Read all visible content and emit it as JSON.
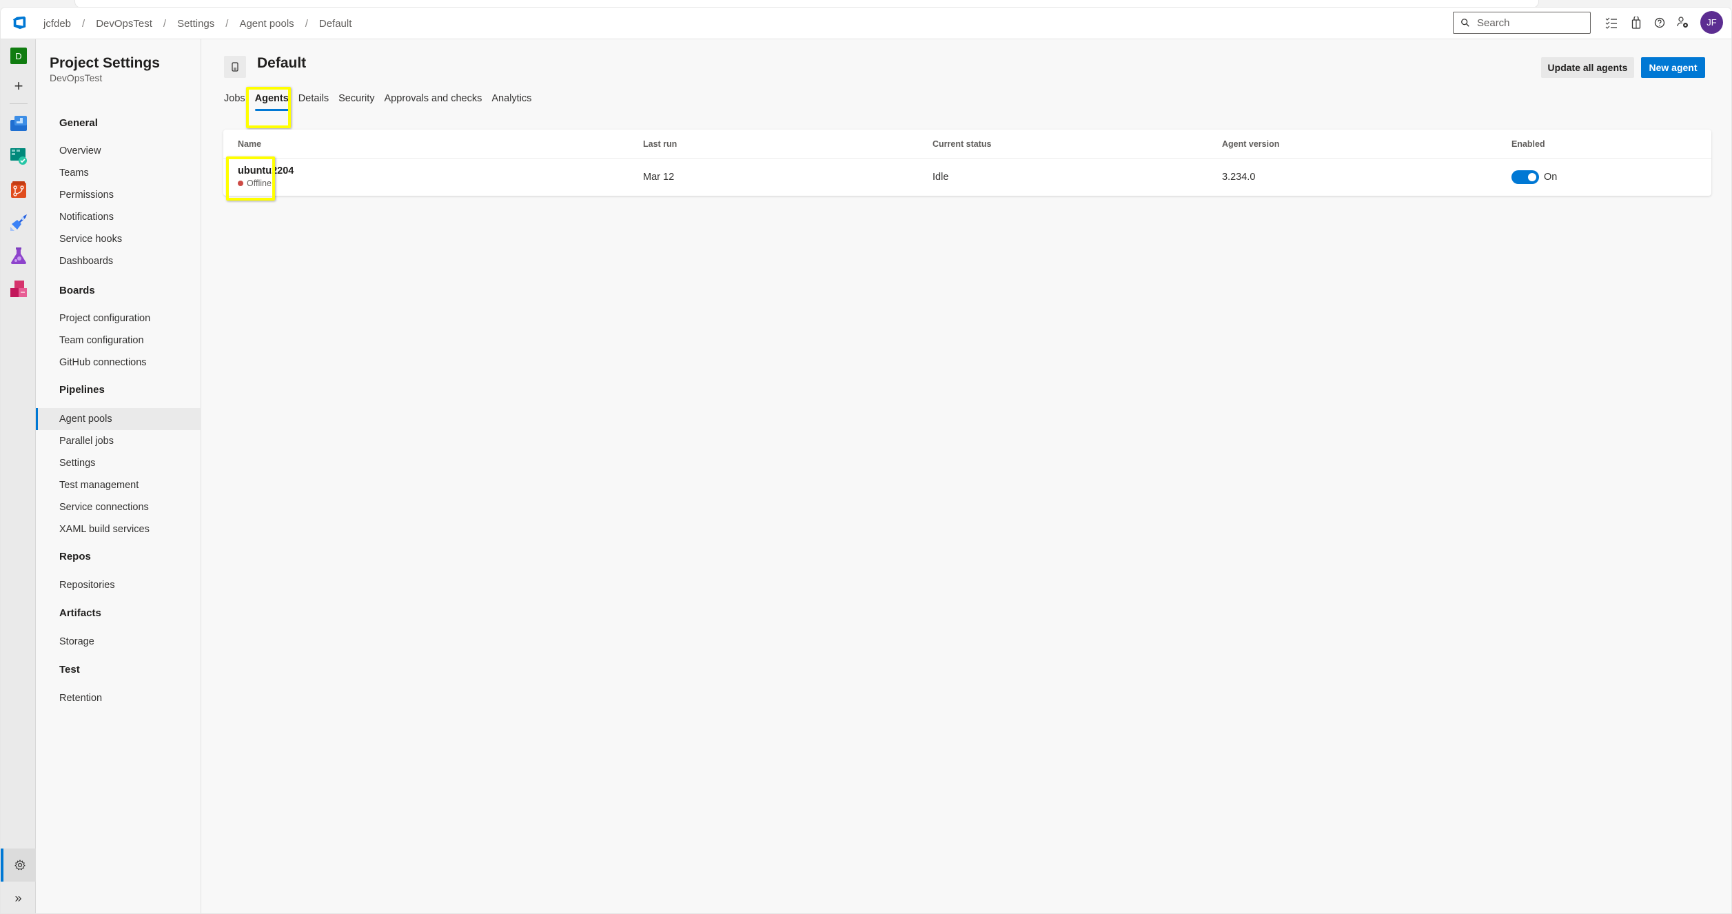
{
  "header": {
    "logo_icon": "azure-devops-logo",
    "breadcrumb": [
      "jcfdeb",
      "DevOpsTest",
      "Settings",
      "Agent pools",
      "Default"
    ],
    "search_placeholder": "Search",
    "icons": [
      "work-items-checklist-icon",
      "marketplace-bag-icon",
      "help-icon",
      "user-settings-icon"
    ],
    "avatar_initials": "JF",
    "avatar_color": "#5c2d91"
  },
  "rail": {
    "project_initial": "D",
    "project_color": "#107c10",
    "add_label": "+",
    "services": [
      "overview",
      "boards",
      "repos",
      "pipelines",
      "test-plans",
      "artifacts"
    ],
    "settings_icon": "gear-icon",
    "expand_label": "»"
  },
  "sidebar": {
    "title": "Project Settings",
    "subtitle": "DevOpsTest",
    "sections": [
      {
        "heading": "General",
        "items": [
          "Overview",
          "Teams",
          "Permissions",
          "Notifications",
          "Service hooks",
          "Dashboards"
        ]
      },
      {
        "heading": "Boards",
        "items": [
          "Project configuration",
          "Team configuration",
          "GitHub connections"
        ]
      },
      {
        "heading": "Pipelines",
        "items": [
          "Agent pools",
          "Parallel jobs",
          "Settings",
          "Test management",
          "Service connections",
          "XAML build services"
        ]
      },
      {
        "heading": "Repos",
        "items": [
          "Repositories"
        ]
      },
      {
        "heading": "Artifacts",
        "items": [
          "Storage"
        ]
      },
      {
        "heading": "Test",
        "items": [
          "Retention"
        ]
      }
    ],
    "active_item": "Agent pools"
  },
  "main": {
    "title": "Default",
    "buttons": {
      "update_all": "Update all agents",
      "new_agent": "New agent"
    },
    "tabs": [
      "Jobs",
      "Agents",
      "Details",
      "Security",
      "Approvals and checks",
      "Analytics"
    ],
    "active_tab": "Agents",
    "table": {
      "columns": [
        "Name",
        "Last run",
        "Current status",
        "Agent version",
        "Enabled"
      ],
      "rows": [
        {
          "name": "ubuntu2204",
          "status": "Offline",
          "status_color": "#cd4a45",
          "last_run": "Mar 12",
          "current_status": "Idle",
          "agent_version": "3.234.0",
          "enabled": true,
          "enabled_label": "On"
        }
      ]
    }
  },
  "accent_color": "#0078d4",
  "highlight_color": "#ffff00"
}
